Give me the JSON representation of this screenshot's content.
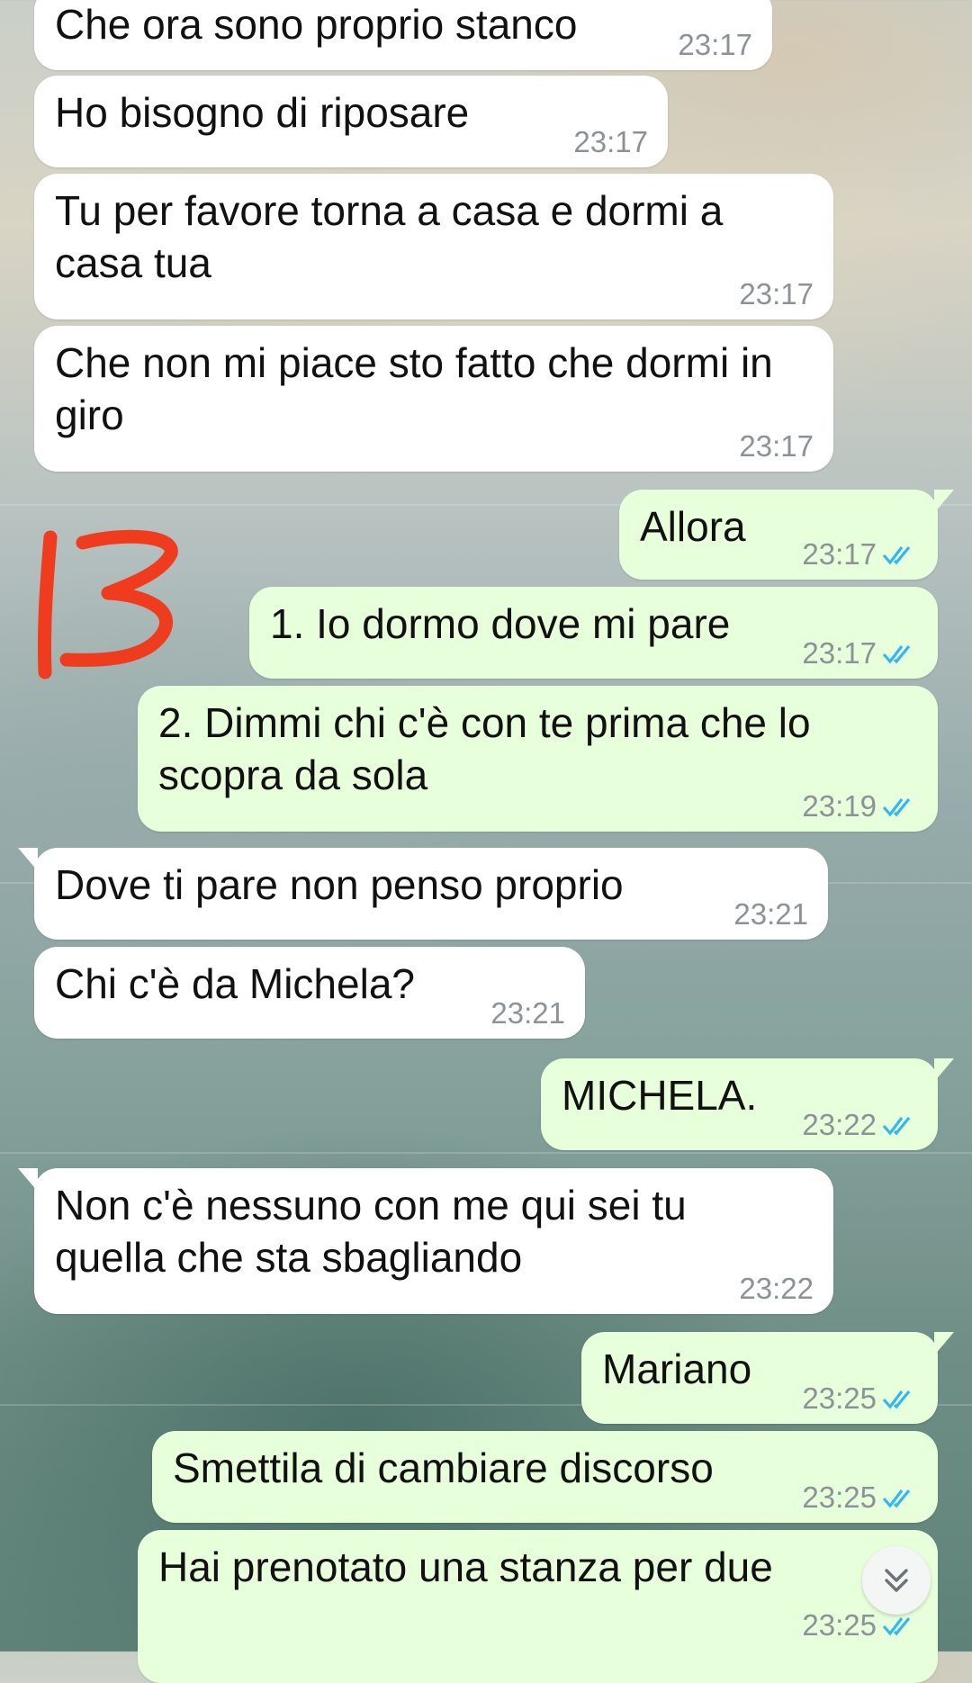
{
  "messages": [
    {
      "text": "Che ora sono proprio stanco",
      "time": "23:17",
      "dir": "in"
    },
    {
      "text": "Ho bisogno di riposare",
      "time": "23:17",
      "dir": "in"
    },
    {
      "text": "Tu per favore torna a casa e dormi a casa tua",
      "time": "23:17",
      "dir": "in"
    },
    {
      "text": "Che non mi piace sto fatto che dormi in giro",
      "time": "23:17",
      "dir": "in"
    },
    {
      "text": "Allora",
      "time": "23:17",
      "dir": "out",
      "status": "read"
    },
    {
      "text": "1. Io dormo dove mi pare",
      "time": "23:17",
      "dir": "out",
      "status": "read"
    },
    {
      "text": "2. Dimmi chi c'è con te prima che lo scopra da sola",
      "time": "23:19",
      "dir": "out",
      "status": "read"
    },
    {
      "text": "Dove ti pare non penso proprio",
      "time": "23:21",
      "dir": "in"
    },
    {
      "text": "Chi c'è da Michela?",
      "time": "23:21",
      "dir": "in"
    },
    {
      "text": "MICHELA.",
      "time": "23:22",
      "dir": "out",
      "status": "read"
    },
    {
      "text": "Non c'è nessuno con me qui sei tu quella che sta sbagliando",
      "time": "23:22",
      "dir": "in"
    },
    {
      "text": "Mariano",
      "time": "23:25",
      "dir": "out",
      "status": "read"
    },
    {
      "text": "Smettila di cambiare discorso",
      "time": "23:25",
      "dir": "out",
      "status": "read"
    },
    {
      "text": "Hai prenotato una stanza per due",
      "time": "23:25",
      "dir": "out",
      "status": "read"
    }
  ],
  "annotation": {
    "label": "13",
    "color": "#f03c1e"
  },
  "colors": {
    "incoming": "#ffffff",
    "outgoing": "#e7ffdb",
    "read_tick": "#34b7f1",
    "time": "#8c9296"
  },
  "icons": {
    "read_receipt": "double-check-icon",
    "scroll_down": "chevron-double-down-icon"
  }
}
